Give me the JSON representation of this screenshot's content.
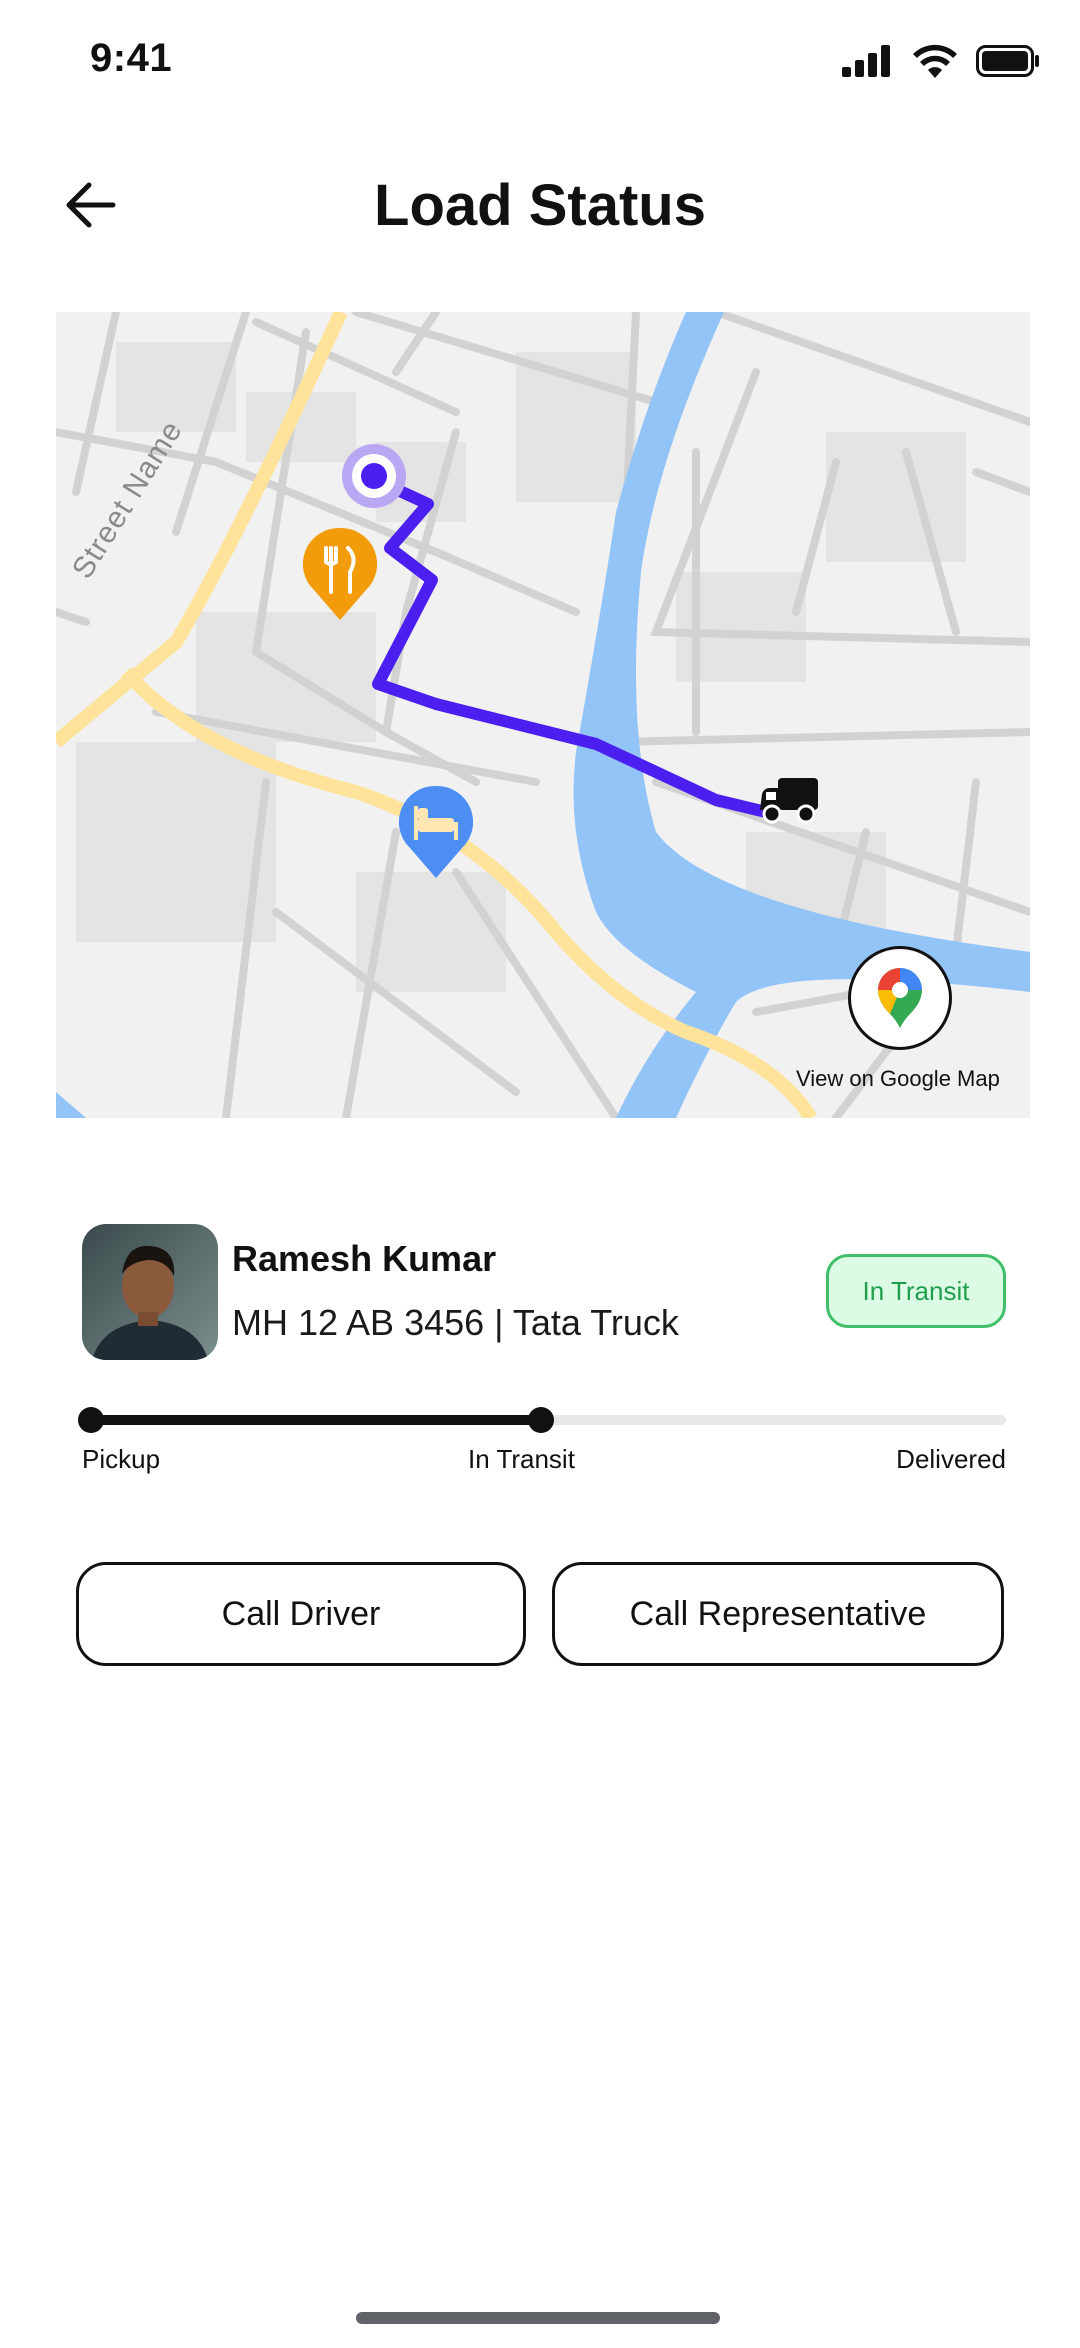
{
  "status_bar": {
    "time": "9:41",
    "icons": [
      "signal-icon",
      "wifi-icon",
      "battery-icon"
    ]
  },
  "header": {
    "title": "Load Status",
    "back_icon": "arrow-left-icon"
  },
  "map": {
    "street_name": "Street Name",
    "google_map_label": "View on Google Map",
    "markers": [
      "origin-marker",
      "restaurant-pin-icon",
      "hotel-pin-icon",
      "truck-icon"
    ],
    "colors": {
      "route": "#4a1ff0",
      "water": "#93c4f7",
      "main_road": "#ffe39a",
      "restaurant_pin": "#f29b0b",
      "hotel_pin": "#4d8ef5"
    }
  },
  "driver": {
    "name": "Ramesh Kumar",
    "vehicle": "MH 12 AB 3456 | Tata Truck",
    "status": "In Transit"
  },
  "progress": {
    "steps": [
      "Pickup",
      "In Transit",
      "Delivered"
    ],
    "current_step": 1,
    "completed_fraction": 0.5
  },
  "actions": {
    "call_driver": "Call Driver",
    "call_representative": "Call Representative"
  }
}
